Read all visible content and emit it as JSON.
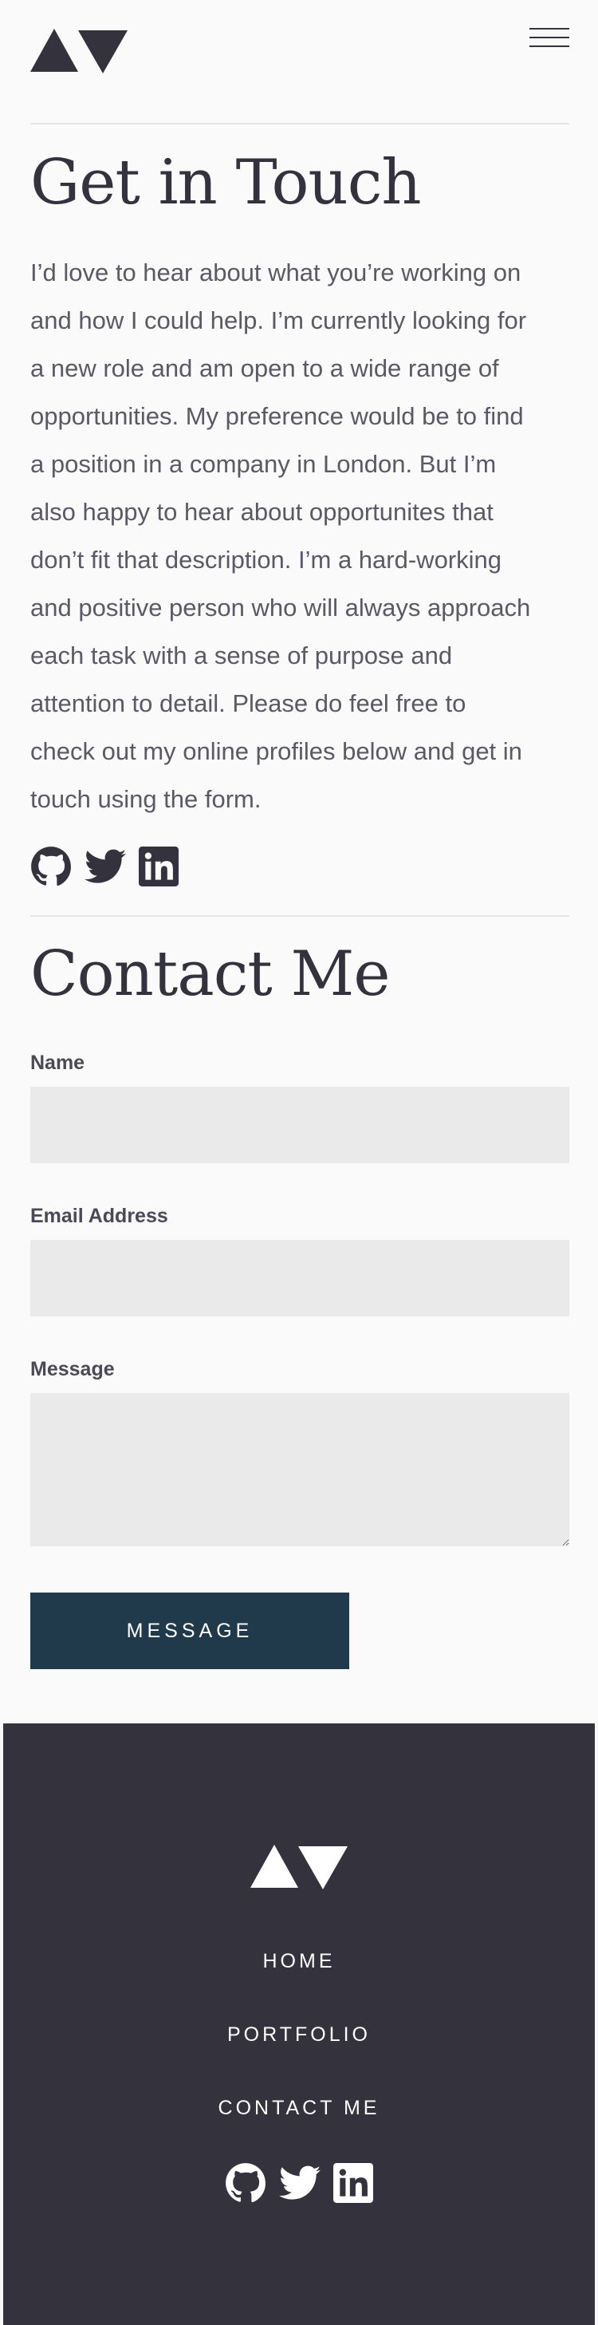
{
  "header": {
    "logo_icon": "brand-triangles-logo",
    "menu_icon": "hamburger-menu-icon"
  },
  "about": {
    "title": "Get in Touch",
    "lines": [
      "I’d love to hear about what you’re working on",
      "and how I could help. I’m currently looking for",
      "a new role and am open to a wide range of",
      "opportunities. My preference would be to find",
      "a position in a company in London. But I’m",
      "also happy to hear about opportunites that",
      "don’t fit that description. I’m a hard-working",
      "and positive person who will always approach",
      "each task with a sense of purpose and",
      "attention to detail. Please do feel free to",
      "check out my online profiles below and get in",
      "touch using the form."
    ],
    "social_icons": [
      "github-icon",
      "twitter-icon",
      "linkedin-icon"
    ]
  },
  "contact": {
    "title": "Contact Me",
    "name_label": "Name",
    "name_value": "",
    "email_label": "Email Address",
    "email_value": "",
    "message_label": "Message",
    "message_value": "",
    "submit_label": "MESSAGE"
  },
  "footer": {
    "nav": [
      "HOME",
      "PORTFOLIO",
      "CONTACT ME"
    ],
    "social_icons": [
      "github-icon",
      "twitter-icon",
      "linkedin-icon"
    ]
  },
  "colors": {
    "background": "#fafafa",
    "text_dark": "#33323d",
    "body_text": "#5a5965",
    "field_bg": "#eaeaeb",
    "button_bg": "#203a4c",
    "footer_bg": "#33323d"
  }
}
